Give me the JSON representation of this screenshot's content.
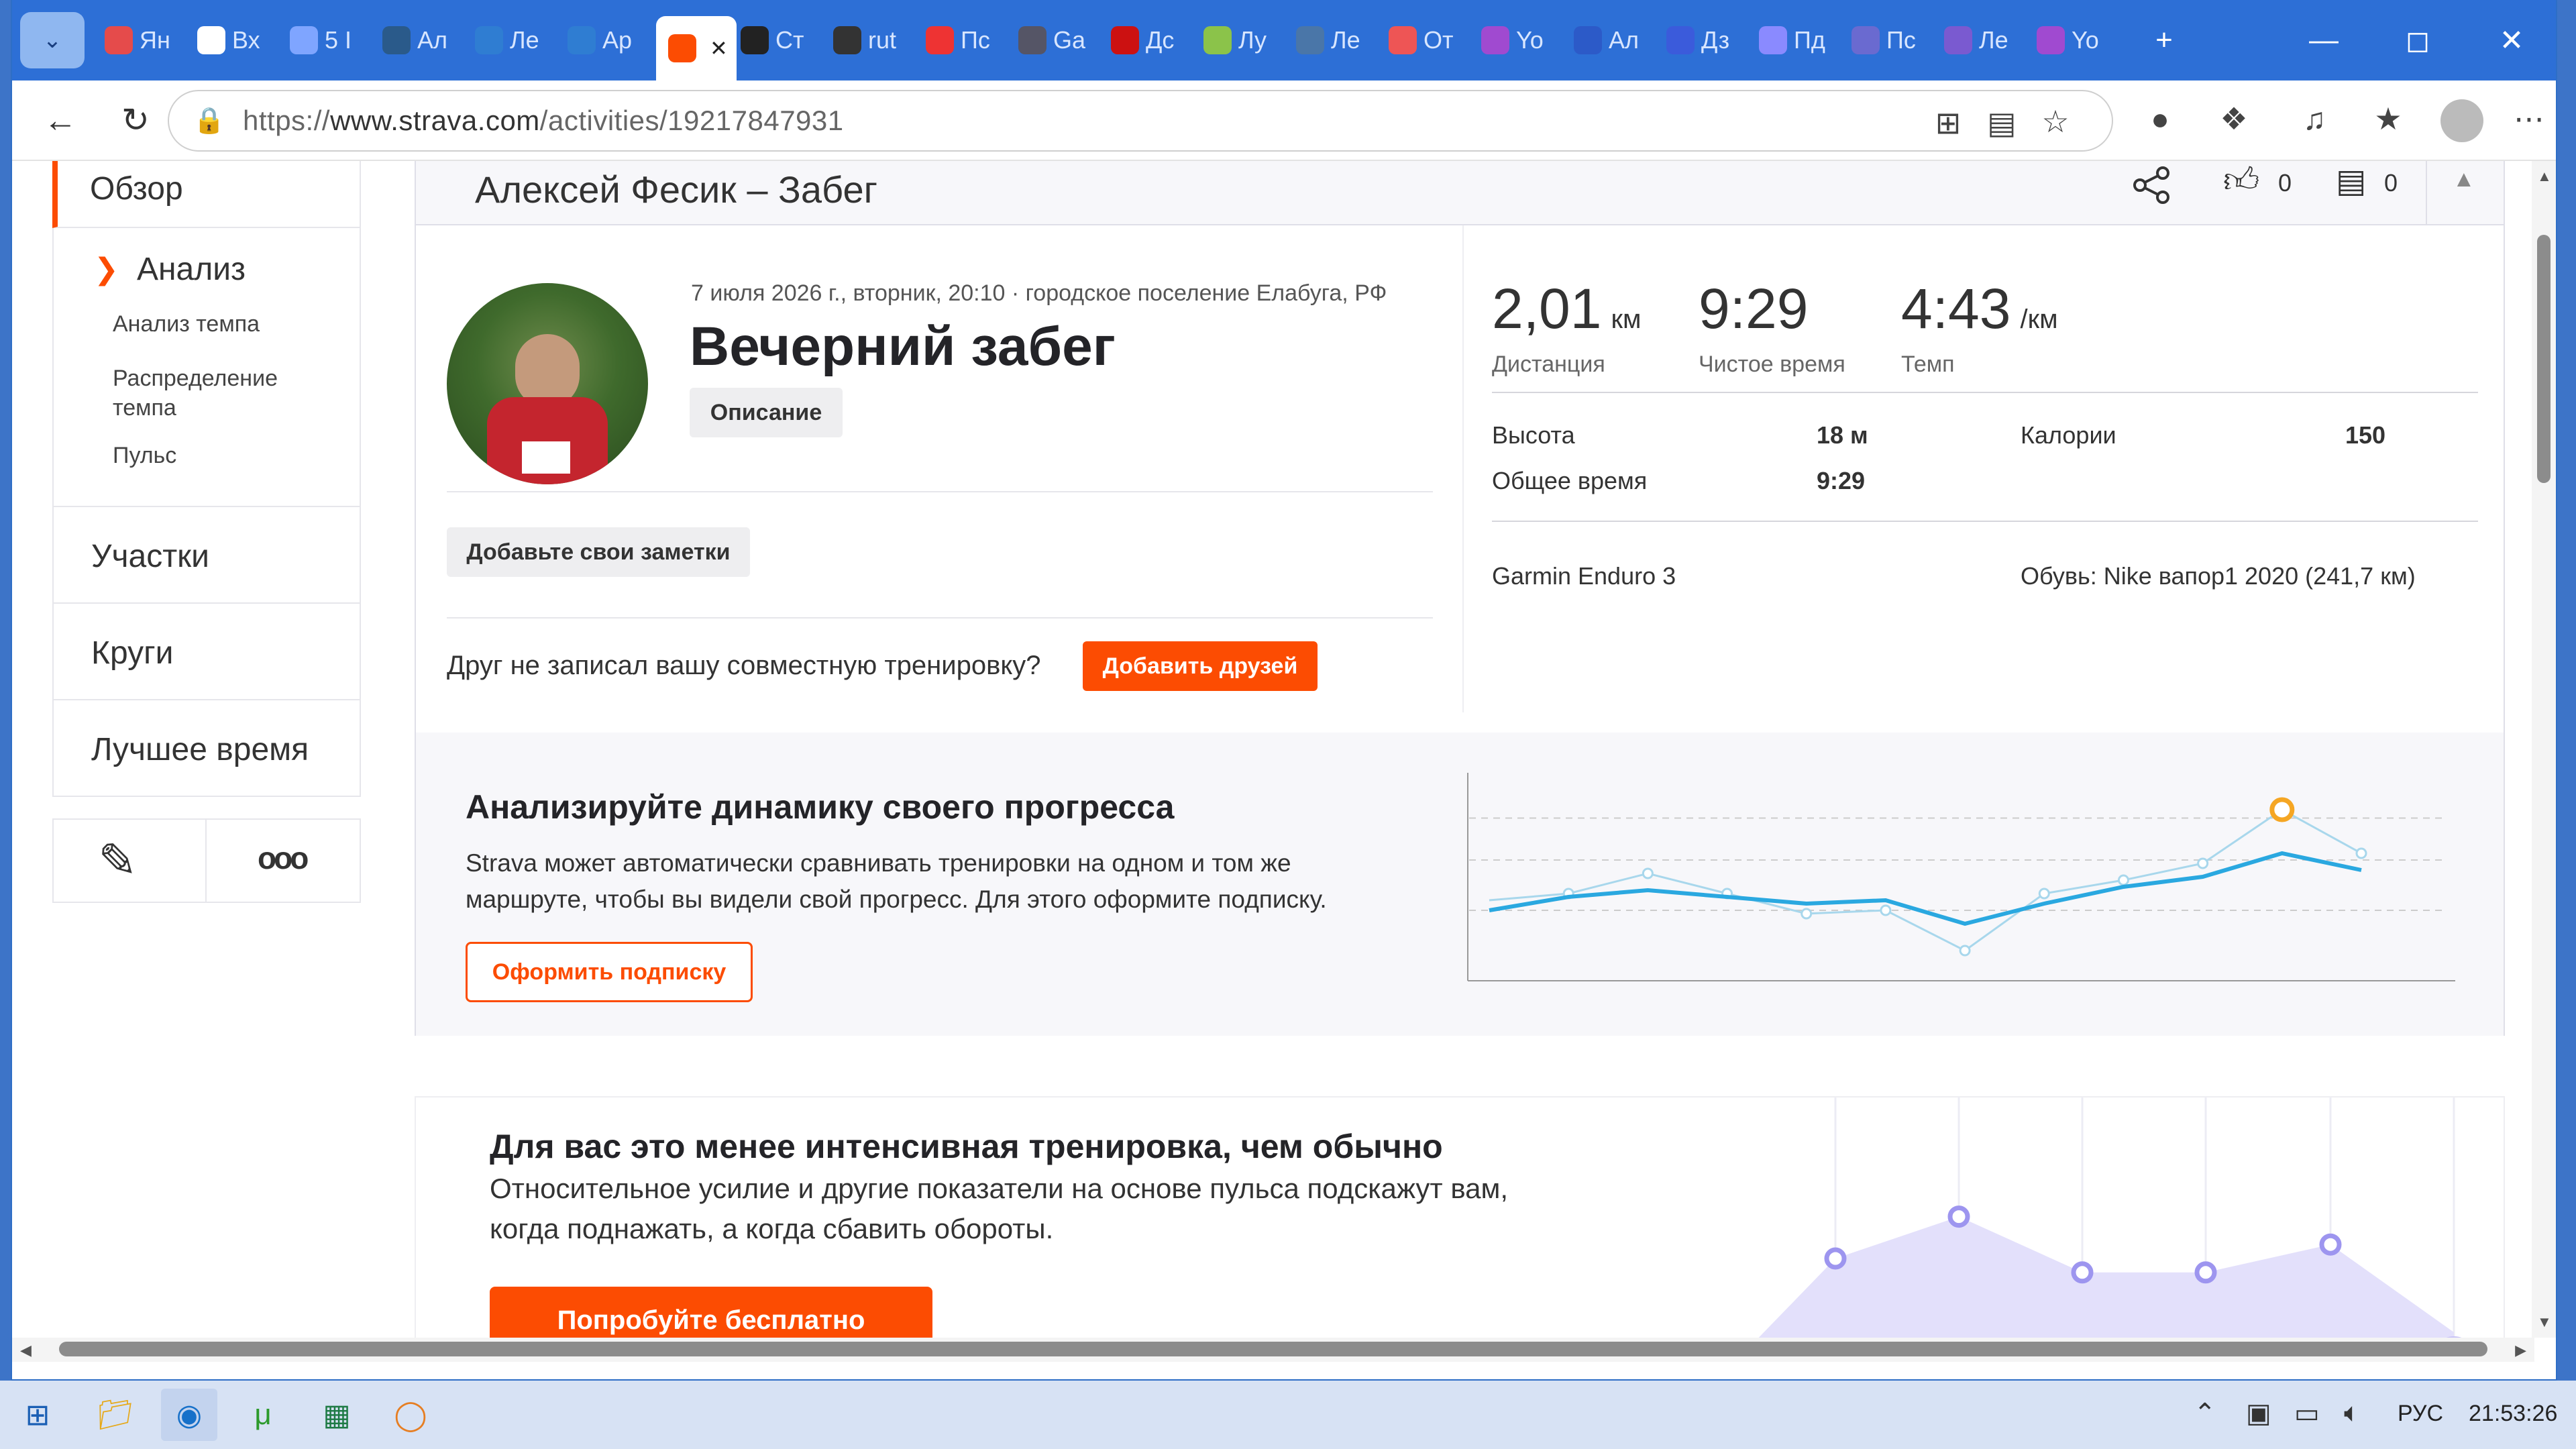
{
  "browser": {
    "tabs": [
      {
        "label": "Ян",
        "icon": "map-pin-icon",
        "color": "#e54b4b"
      },
      {
        "label": "Вх",
        "icon": "mail-icon",
        "color": "#ffffff"
      },
      {
        "label": "5 І",
        "icon": "b-icon",
        "color": "#7fa5ff"
      },
      {
        "label": "Ал",
        "icon": "runner-icon",
        "color": "#2a5a8a"
      },
      {
        "label": "Ле",
        "icon": "sb-icon",
        "color": "#2f7dd2"
      },
      {
        "label": "Ар",
        "icon": "sb-icon",
        "color": "#2f7dd2"
      },
      {
        "label": "",
        "icon": "strava-icon",
        "color": "#fc4c02"
      },
      {
        "label": "Ст",
        "icon": "dark-drop-icon",
        "color": "#222"
      },
      {
        "label": "rut",
        "icon": "rutracker-icon",
        "color": "#333"
      },
      {
        "label": "Пс",
        "icon": "umbrella-icon",
        "color": "#e33"
      },
      {
        "label": "Ga",
        "icon": "mountain-icon",
        "color": "#556"
      },
      {
        "label": "Дс",
        "icon": "flag-icon",
        "color": "#c11"
      },
      {
        "label": "Лу",
        "icon": "circle-up-icon",
        "color": "#8bc34a"
      },
      {
        "label": "Ле",
        "icon": "vk-icon",
        "color": "#4a76a8"
      },
      {
        "label": "От",
        "icon": "check-icon",
        "color": "#e55"
      },
      {
        "label": "Yo",
        "icon": "video-icon",
        "color": "#a04ad0"
      },
      {
        "label": "Ал",
        "icon": "r-icon",
        "color": "#2c5ac8"
      },
      {
        "label": "Дз",
        "icon": "star4-icon",
        "color": "#3b5bdb"
      },
      {
        "label": "Пд",
        "icon": "ya-icon",
        "color": "#8a8aff"
      },
      {
        "label": "Пс",
        "icon": "play-icon",
        "color": "#6a6ad0"
      },
      {
        "label": "Ле",
        "icon": "play-icon",
        "color": "#7a5ad0"
      },
      {
        "label": "Yo",
        "icon": "video-icon",
        "color": "#a04ad0"
      }
    ],
    "active_tab": 6,
    "url_prefix": "https://",
    "url_host": "www.strava.com",
    "url_path": "/activities/19217847931"
  },
  "sidebar": {
    "overview": "Обзор",
    "analysis": "Анализ",
    "sub_items": [
      "Анализ темпа",
      "Распределение темпа",
      "Пульс"
    ],
    "sections": [
      "Участки",
      "Круги",
      "Лучшее время"
    ]
  },
  "header": {
    "title": "Алексей Фесик – Забег",
    "kudos_count": "0",
    "comments_count": "0"
  },
  "activity": {
    "meta": "7 июля 2026 г., вторник, 20:10 · городское поселение Елабуга, РФ",
    "name": "Вечерний забег",
    "description_btn": "Описание",
    "notes_btn": "Добавьте свои заметки",
    "friend_prompt": "Друг не записал вашу совместную тренировку?",
    "add_friends_btn": "Добавить друзей"
  },
  "stats": {
    "distance_value": "2,01",
    "distance_unit": "км",
    "distance_label": "Дистанция",
    "moving_time_value": "9:29",
    "moving_time_label": "Чистое время",
    "pace_value": "4:43",
    "pace_unit": "/км",
    "pace_label": "Темп",
    "elevation_label": "Высота",
    "elevation_value": "18 м",
    "calories_label": "Калории",
    "calories_value": "150",
    "elapsed_label": "Общее время",
    "elapsed_value": "9:29",
    "device": "Garmin Enduro 3",
    "shoes": "Обувь: Nike вапор1 2020 (241,7 км)"
  },
  "promo1": {
    "title": "Анализируйте динамику своего прогресса",
    "text1": "Strava может автоматически сравнивать тренировки на одном и том же",
    "text2": "маршруте, чтобы вы видели свой прогресс. Для этого оформите подписку.",
    "button": "Оформить подписку",
    "line_a": [
      0.3,
      0.38,
      0.42,
      0.38,
      0.34,
      0.36,
      0.22,
      0.34,
      0.44,
      0.5,
      0.64,
      0.54
    ],
    "line_b": [
      0.36,
      0.4,
      0.52,
      0.4,
      0.28,
      0.3,
      0.06,
      0.4,
      0.48,
      0.58,
      0.9,
      0.64
    ]
  },
  "promo2": {
    "title": "Для вас это менее интенсивная тренировка, чем обычно",
    "text1": "Относительное усилие и другие показатели на основе пульса подскажут вам,",
    "text2": "когда поднажать, а когда сбавить обороты.",
    "button": "Попробуйте бесплатно",
    "points": [
      0.5,
      0.74,
      0.42,
      0.42,
      0.58,
      0.0
    ]
  },
  "taskbar": {
    "lang": "РУС",
    "time": "21:53:26"
  },
  "colors": {
    "strava_orange": "#fc4c02",
    "chart_blue": "#2aa8e0",
    "chart_light": "#a8d7ec",
    "promo_bg": "#f7f7fa",
    "purple": "#9d95ef"
  }
}
